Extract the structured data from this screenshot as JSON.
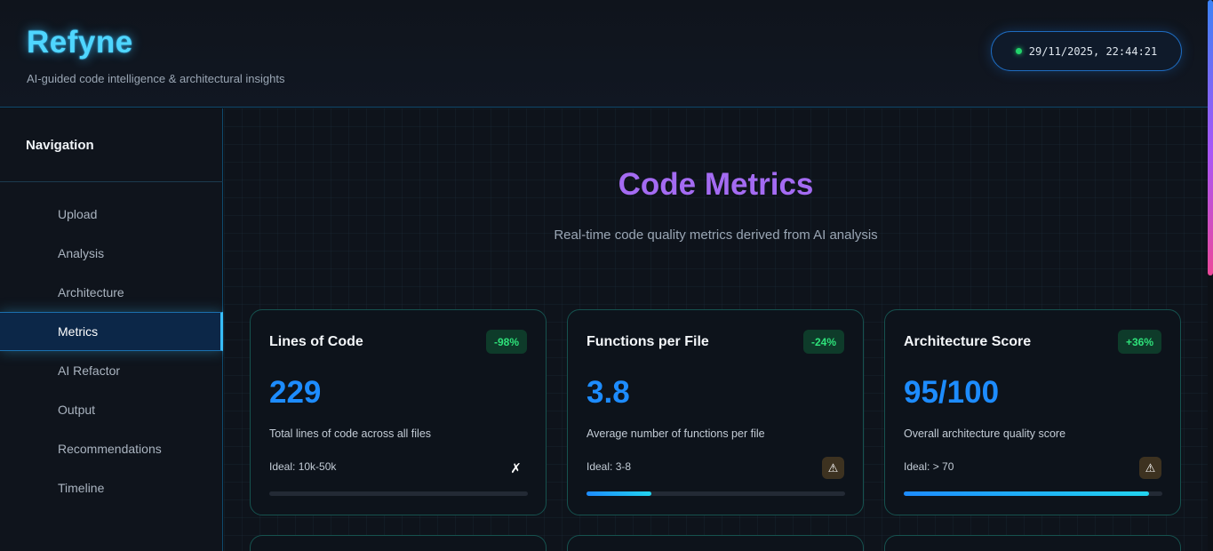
{
  "header": {
    "logo": "Refyne",
    "tagline": "AI-guided code intelligence & architectural insights",
    "clock": "29/11/2025, 22:44:21",
    "clock_status_color": "#22d36b"
  },
  "sidebar": {
    "title": "Navigation",
    "items": [
      {
        "label": "Upload",
        "active": false
      },
      {
        "label": "Analysis",
        "active": false
      },
      {
        "label": "Architecture",
        "active": false
      },
      {
        "label": "Metrics",
        "active": true
      },
      {
        "label": "AI Refactor",
        "active": false
      },
      {
        "label": "Output",
        "active": false
      },
      {
        "label": "Recommendations",
        "active": false
      },
      {
        "label": "Timeline",
        "active": false
      }
    ]
  },
  "main": {
    "title": "Code Metrics",
    "subtitle": "Real-time code quality metrics derived from AI analysis",
    "cards": [
      {
        "title": "Lines of Code",
        "badge": "-98%",
        "value": "229",
        "description": "Total lines of code across all files",
        "ideal": "Ideal: 10k-50k",
        "status_icon": "✗",
        "status_name": "cross-icon",
        "progress_pct": 0
      },
      {
        "title": "Functions per File",
        "badge": "-24%",
        "value": "3.8",
        "description": "Average number of functions per file",
        "ideal": "Ideal: 3-8",
        "status_icon": "⚠",
        "status_name": "warning-icon",
        "progress_pct": 25
      },
      {
        "title": "Architecture Score",
        "badge": "+36%",
        "value": "95/100",
        "description": "Overall architecture quality score",
        "ideal": "Ideal: > 70",
        "status_icon": "⚠",
        "status_name": "warning-icon",
        "progress_pct": 95
      }
    ]
  },
  "colors": {
    "accent_cyan": "#4fd6ff",
    "accent_blue": "#1d8cff",
    "accent_purple": "#a46bf2",
    "badge_green": "#2ee27a",
    "card_border": "#16524f"
  }
}
